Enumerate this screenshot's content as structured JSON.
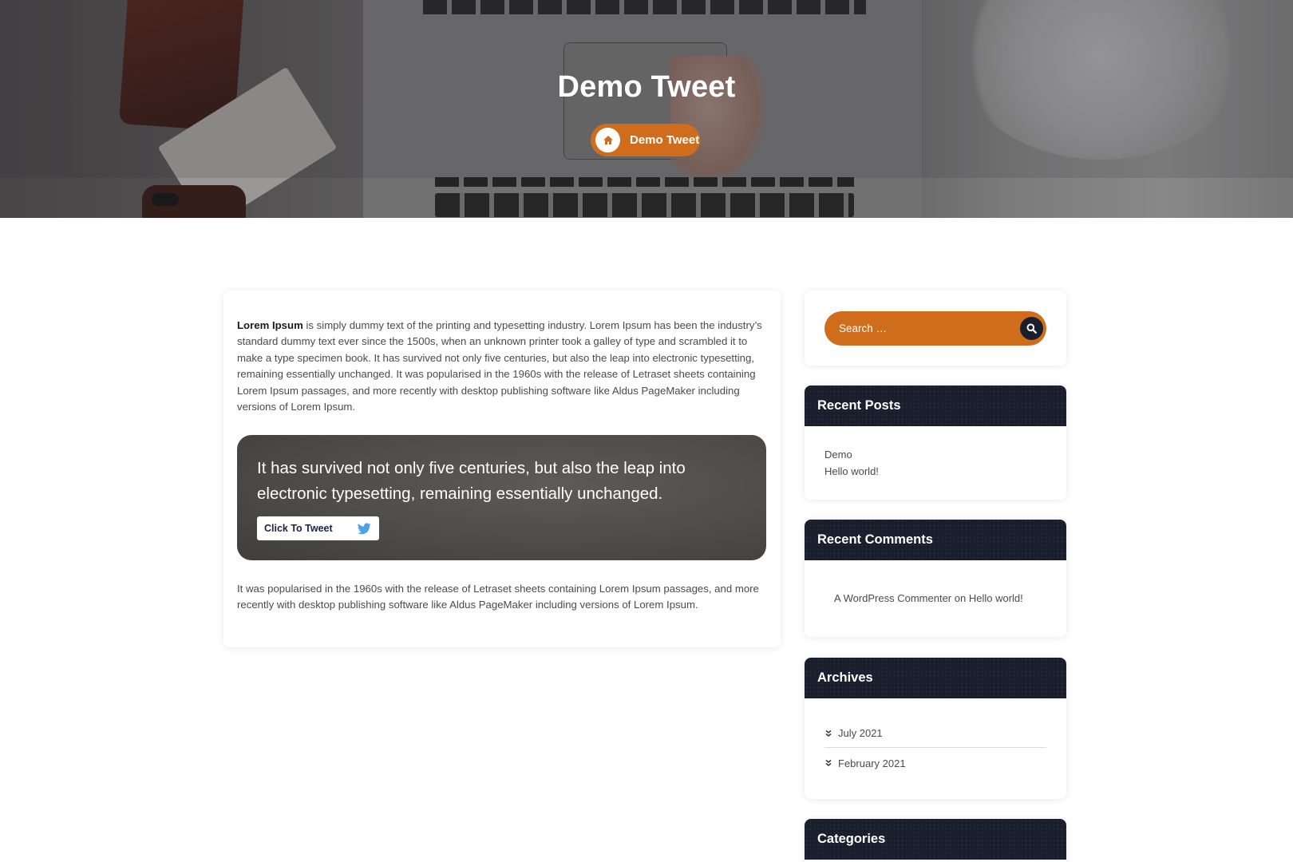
{
  "hero": {
    "title": "Demo Tweet",
    "breadcrumb_label": "Demo Tweet",
    "breadcrumb_icon": "home-icon"
  },
  "article": {
    "intro_bold": "Lorem Ipsum",
    "intro_text": " is simply dummy text of the printing and typesetting industry. Lorem Ipsum has been the industry’s standard dummy text ever since the 1500s, when an unknown printer took a galley of type and scrambled it to make a type specimen book. It has survived not only five centuries, but also the leap into electronic typesetting, remaining essentially unchanged. It was popularised in the 1960s with the release of Letraset sheets containing Lorem Ipsum passages, and more recently with desktop publishing software like Aldus PageMaker including versions of Lorem Ipsum.",
    "tweet_quote": "It has survived not only five centuries, but also the leap into electronic typesetting, remaining essentially unchanged.",
    "tweet_button_label": "Click To Tweet",
    "tweet_icon": "twitter-bird-icon",
    "outro_text": "It was popularised in the 1960s with the release of Letraset sheets containing Lorem Ipsum passages, and more recently with desktop publishing software like Aldus PageMaker including versions of Lorem Ipsum."
  },
  "sidebar": {
    "search": {
      "placeholder": "Search …",
      "icon": "search-icon"
    },
    "recent_posts": {
      "title": "Recent Posts",
      "items": [
        "Demo",
        "Hello world!"
      ]
    },
    "recent_comments": {
      "title": "Recent Comments",
      "author": "A WordPress Commenter",
      "connector": "on",
      "post": "Hello world!"
    },
    "archives": {
      "title": "Archives",
      "items": [
        "July 2021",
        "February 2021"
      ]
    },
    "categories": {
      "title": "Categories"
    }
  },
  "colors": {
    "accent": "#cf6d1d",
    "widget_header": "#1a1d2b",
    "tweet_bird": "#4aa3e8"
  }
}
